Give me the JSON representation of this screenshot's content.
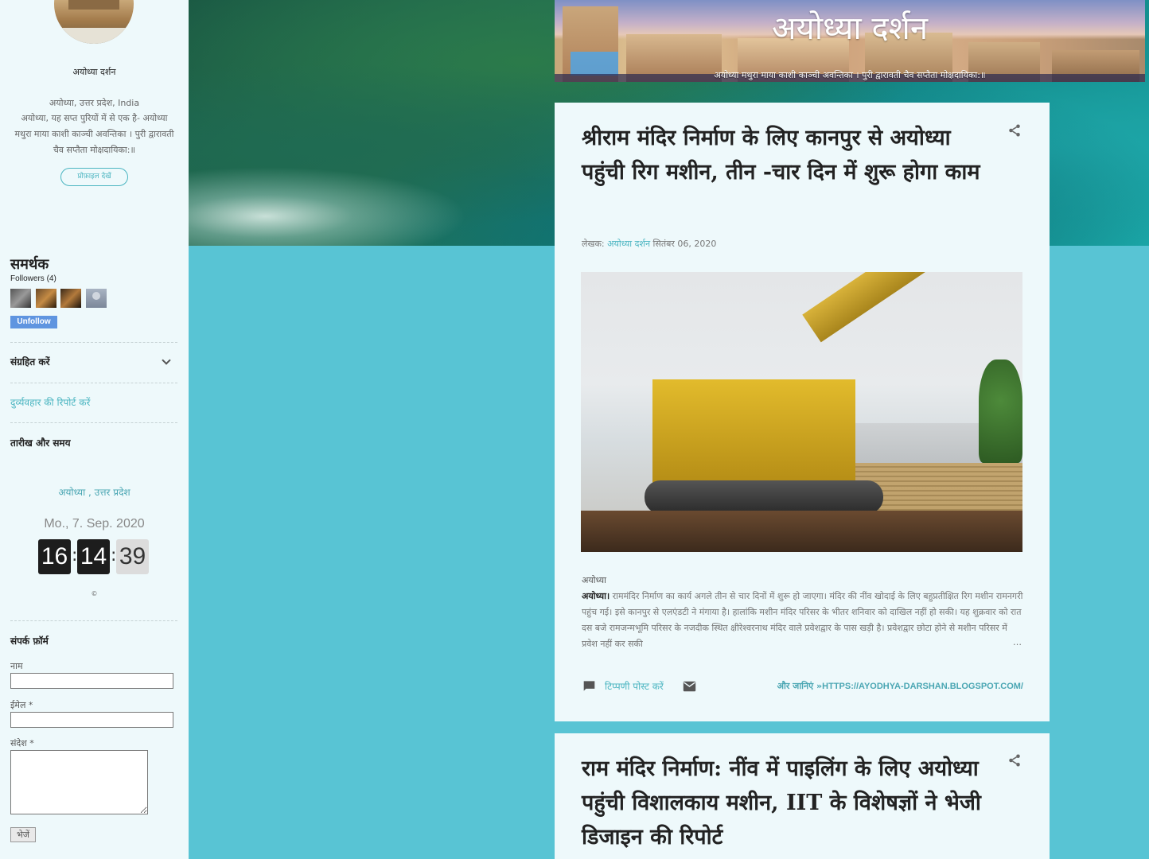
{
  "sidebar": {
    "blog_name": "अयोध्या दर्शन",
    "location": "अयोध्या, उत्तर प्रदेश, India",
    "about": "अयोध्या, यह सप्त पुरियों में से एक है- अयोध्या मथुरा माया काशी काञ्ची अवन्तिका । पुरी द्वारावती चैव सप्तैता मोक्षदायिका:॥",
    "profile_button": "प्रोफ़ाइल देखें",
    "followers_heading": "समर्थक",
    "followers_count": "Followers (4)",
    "unfollow_label": "Unfollow",
    "archive_label": "संग्रहित करें",
    "report_label": "दुर्व्यवहार की रिपोर्ट करें",
    "datetime_heading": "तारीख और समय",
    "clock": {
      "location": "अयोध्या , उत्तर प्रदेश",
      "date": "Mo., 7. Sep. 2020",
      "hours": "16",
      "minutes": "14",
      "seconds": "39",
      "copyright": "©"
    },
    "contact": {
      "heading": "संपर्क फ़ॉर्म",
      "name_label": "नाम",
      "email_label": "ईमेल *",
      "message_label": "संदेश *",
      "send_label": "भेजें"
    }
  },
  "header": {
    "title": "अयोध्या दर्शन",
    "subtitle": "अयोध्या मथुरा माया काशी काञ्ची अवन्तिका । पुरी द्वारावती चैव सप्तैता मोक्षदायिका:॥"
  },
  "posts": [
    {
      "title": "श्रीराम मंदिर निर्माण के लिए कानपुर से अयोध्या पहुंची रिग मशीन, तीन -चार दिन में शुरू होगा काम",
      "meta_prefix": "लेखक:",
      "author": "अयोध्या दर्शन",
      "date": "सितंबर 06, 2020",
      "label": "अयोध्या",
      "snippet_lead": "अयोध्या।",
      "snippet": "राममंदिर निर्माण का कार्य अगले तीन से चार दिनों में शुरू हो जाएगा। मंदिर की नींव खोदाई के लिए बहुप्रतीक्षित रिग मशीन रामनगरी पहुंच गई। इसे कानपुर से एलएंडटी ने मंगाया है। हालांकि मशीन मंदिर परिसर के भीतर शनिवार को दाखिल नहीं हो सकी। यह शुक्रवार को रात दस बजे रामजन्मभूमि परिसर के नजदीक स्थित क्षीरेश्वरनाथ मंदिर वाले प्रवेशद्वार के पास खड़ी है। प्रवेशद्वार छोटा होने से मशीन परिसर में प्रवेश नहीं कर सकी",
      "ellipsis": "…",
      "comment_label": "टिप्पणी पोस्ट करें",
      "readmore_lead": "और जानिएं »",
      "readmore_url": "HTTPS://AYODHYA-DARSHAN.BLOGSPOT.COM/"
    },
    {
      "title": "राम मंदिर निर्माण: नींव में पाइलिंग के लिए अयोध्या पहुंची विशालकाय मशीन, IIT के विशेषज्ञों ने भेजी डिजाइन की रिपोर्ट"
    }
  ],
  "colors": {
    "accent": "#4bb5c1",
    "page_bg": "#58c4d4",
    "card_bg": "#eef9fb",
    "unfollow_bg": "#5f95e0"
  },
  "icons": [
    "share-icon",
    "comment-icon",
    "mail-icon",
    "chevron-down-icon"
  ]
}
